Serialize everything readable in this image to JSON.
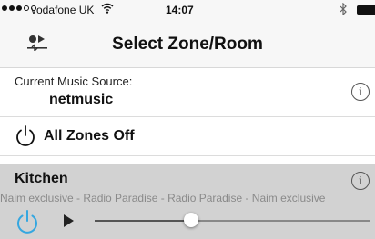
{
  "status_bar": {
    "carrier": "vodafone UK",
    "time": "14:07",
    "signal_bars": 3,
    "signal_total": 5
  },
  "nav": {
    "title": "Select Zone/Room",
    "icon": "source-switch-icon"
  },
  "source": {
    "label": "Current Music Source:",
    "value": "netmusic",
    "info_icon": "info-icon"
  },
  "all_zones": {
    "label": "All Zones Off",
    "icon": "power-icon"
  },
  "zones": [
    {
      "name": "Kitchen",
      "now_playing": "Naim exclusive - Radio Paradise - Radio Paradise - Naim exclusive",
      "volume": 0.35,
      "power_icon": "power-icon",
      "play_icon": "play-icon"
    }
  ],
  "colors": {
    "power_active": "#35a7e0",
    "zone_background": "#d2d2d2",
    "bar_background": "#f7f7f7"
  }
}
